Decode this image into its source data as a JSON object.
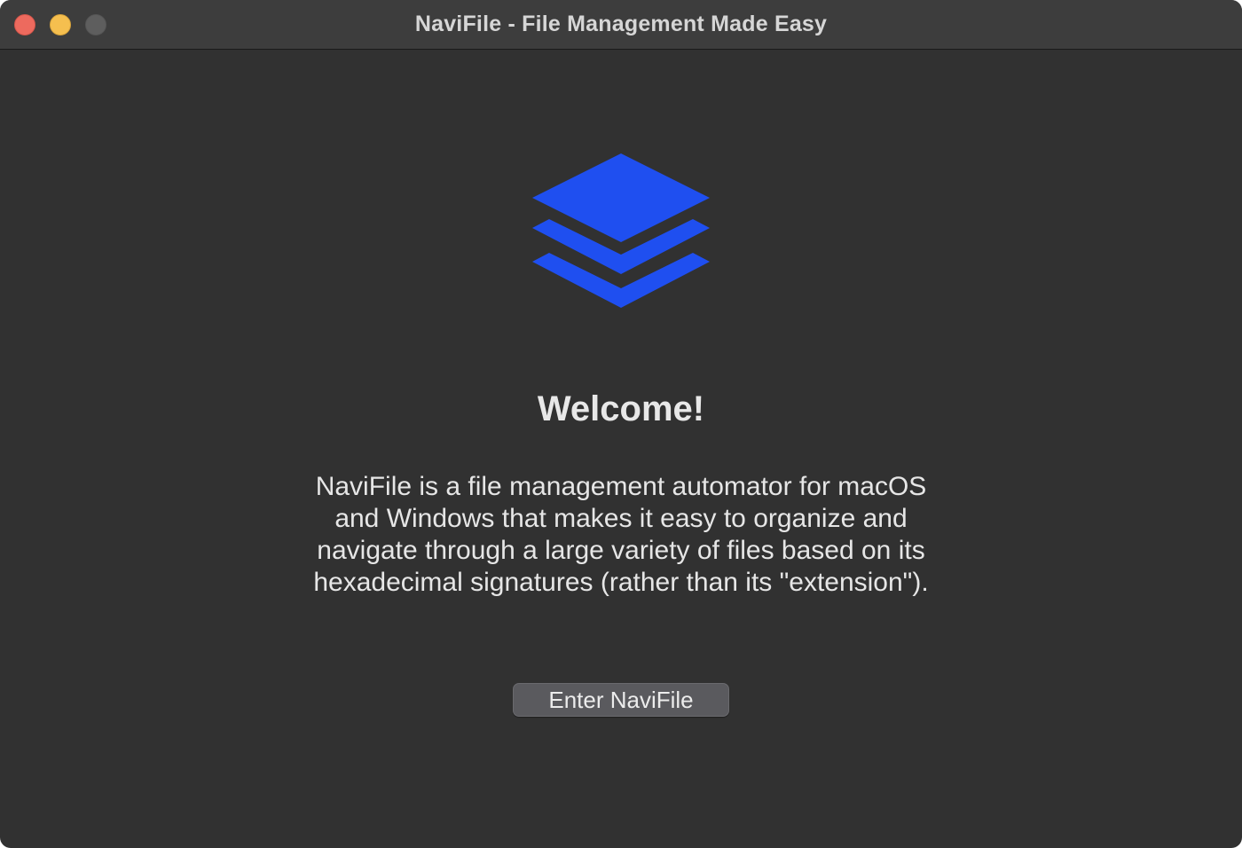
{
  "window": {
    "title": "NaviFile - File Management Made Easy"
  },
  "traffic_lights": [
    {
      "name": "close",
      "color": "#ed6a5e"
    },
    {
      "name": "minimize",
      "color": "#f5bf4f"
    },
    {
      "name": "zoom",
      "color": "#5e5e5e"
    }
  ],
  "logo": {
    "icon": "layers-stack-icon",
    "color": "#1f4ff0"
  },
  "welcome": {
    "heading": "Welcome!",
    "description_lines": [
      "NaviFile is a file management automator for macOS",
      "and Windows that makes it easy to organize and",
      "navigate through a large variety of files based on its",
      "hexadecimal signatures (rather than its \"extension\")."
    ]
  },
  "actions": {
    "enter_label": "Enter NaviFile"
  }
}
